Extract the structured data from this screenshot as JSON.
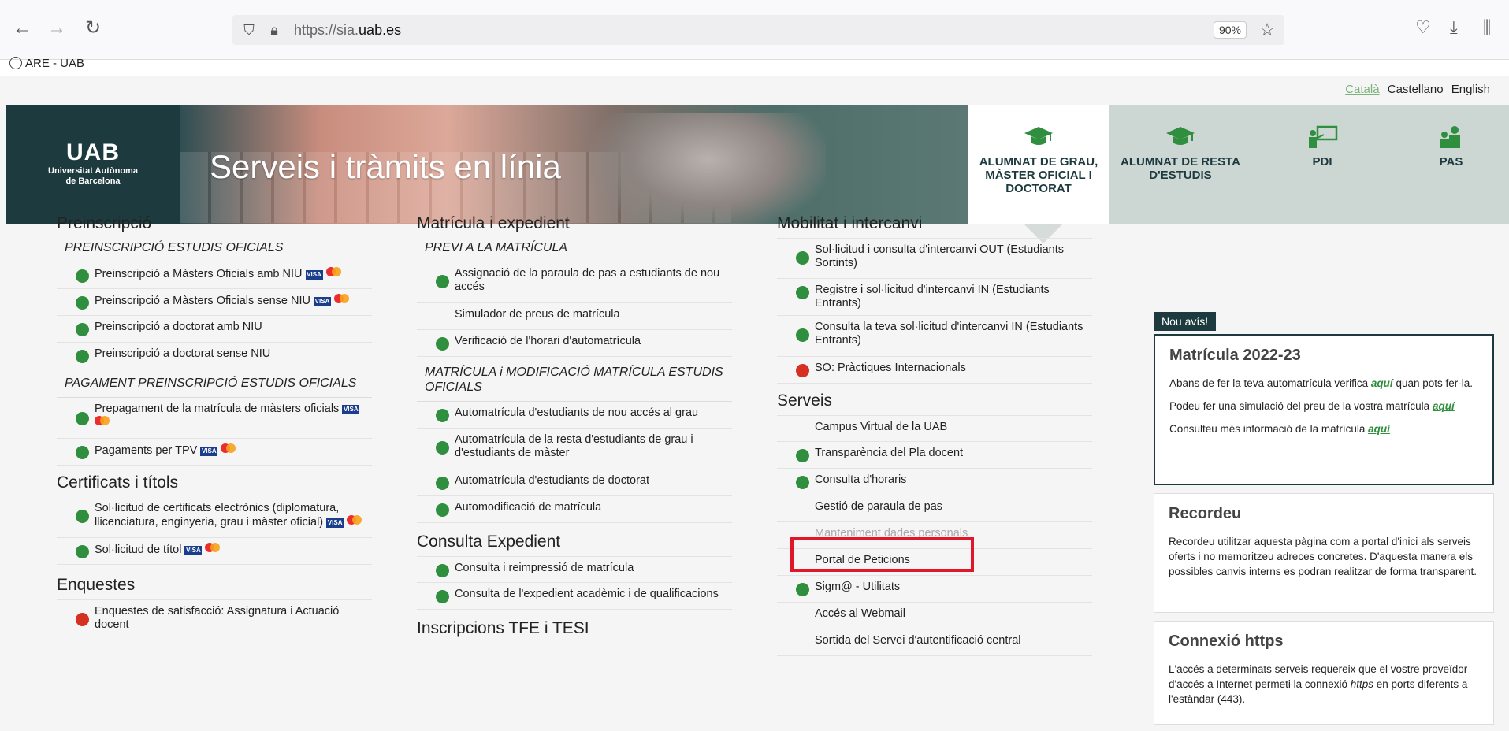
{
  "browser": {
    "url_prefix": "https://sia.",
    "url_domain": "uab.es",
    "zoom": "90%",
    "bookmark": "ARE - UAB"
  },
  "lang": {
    "ca": "Català",
    "es": "Castellano",
    "en": "English"
  },
  "header": {
    "logo": "UAB",
    "logo_sub1": "Universitat Autònoma",
    "logo_sub2": "de Barcelona",
    "title": "Serveis i tràmits en línia",
    "tabs": [
      {
        "line1": "ALUMNAT DE GRAU,",
        "line2": "MÀSTER OFICIAL I",
        "line3": "DOCTORAT",
        "icon": "graduation-cap-icon"
      },
      {
        "line1": "ALUMNAT DE RESTA",
        "line2": "D'ESTUDIS",
        "icon": "graduation-cap-icon"
      },
      {
        "line1": "PDI",
        "icon": "teacher-board-icon"
      },
      {
        "line1": "PAS",
        "icon": "staff-icon"
      }
    ]
  },
  "col1": {
    "h_preins": "Preinscripció",
    "sub_preins": "PREINSCRIPCIÓ ESTUDIS OFICIALS",
    "preins_items": [
      "Preinscripció a Màsters Oficials amb NIU",
      "Preinscripció a Màsters Oficials sense NIU",
      "Preinscripció a doctorat amb NIU",
      "Preinscripció a doctorat sense NIU"
    ],
    "sub_pagament": "PAGAMENT PREINSCRIPCIÓ ESTUDIS OFICIALS",
    "pag_items": [
      "Prepagament de la matrícula de màsters oficials",
      "Pagaments per TPV"
    ],
    "h_cert": "Certificats i títols",
    "cert_items": [
      "Sol·licitud de certificats electrònics (diplomatura, llicenciatura, enginyeria, grau i màster oficial)",
      "Sol·licitud de títol"
    ],
    "h_enq": "Enquestes",
    "enq_items": [
      "Enquestes de satisfacció: Assignatura i Actuació docent"
    ]
  },
  "col2": {
    "h_mat": "Matrícula i expedient",
    "sub_previ": "PREVI A LA MATRÍCULA",
    "previ_items": [
      "Assignació de la paraula de pas a estudiants de nou accés",
      "Simulador de preus de matrícula",
      "Verificació de l'horari d'automatrícula"
    ],
    "sub_mod": "MATRÍCULA i MODIFICACIÓ MATRÍCULA ESTUDIS OFICIALS",
    "mod_items": [
      "Automatrícula d'estudiants de nou accés al grau",
      "Automatrícula de la resta d'estudiants de grau i d'estudiants de màster",
      "Automatrícula d'estudiants de doctorat",
      "Automodificació de matrícula"
    ],
    "h_exp": "Consulta Expedient",
    "exp_items": [
      "Consulta i reimpressió de matrícula",
      "Consulta de l'expedient acadèmic i de qualificacions"
    ],
    "h_tfe": "Inscripcions TFE i TESI"
  },
  "col3": {
    "h_mob": "Mobilitat i intercanvi",
    "mob_items": [
      "Sol·licitud i consulta d'intercanvi OUT (Estudiants Sortints)",
      "Registre i sol·licitud d'intercanvi IN (Estudiants Entrants)",
      "Consulta la teva sol·licitud d'intercanvi IN (Estudiants Entrants)",
      "SO: Pràctiques Internacionals"
    ],
    "h_serv": "Serveis",
    "serv_items": [
      "Campus Virtual de la UAB",
      "Transparència del Pla docent",
      "Consulta d'horaris",
      "Gestió de paraula de pas",
      "Manteniment dades personals",
      "Portal de Peticions",
      "Sigm@ - Utilitats",
      "Accés al Webmail",
      "Sortida del Servei d'autentificació central"
    ]
  },
  "news": {
    "badge": "Nou avís!",
    "title": "Matrícula 2022-23",
    "p1": "Abans de fer la teva automatrícula verifica",
    "p1b": "quan pots fer-la.",
    "p2": "Podeu fer una simulació del preu de la vostra matrícula",
    "p3": "Consulteu més informació de la matrícula",
    "link": "aquí"
  },
  "recordeu": {
    "title": "Recordeu",
    "text": "Recordeu utilitzar aquesta pàgina com a portal d'inici als serveis oferts i no memoritzeu adreces concretes. D'aquesta manera els possibles canvis interns es podran realitzar de forma transparent."
  },
  "https": {
    "title": "Connexió https",
    "text1": "L'accés a determinats serveis requereix que el vostre proveïdor d'accés a Internet permeti la connexió",
    "em": "https",
    "text2": "en ports diferents a l'estàndar (443)."
  }
}
